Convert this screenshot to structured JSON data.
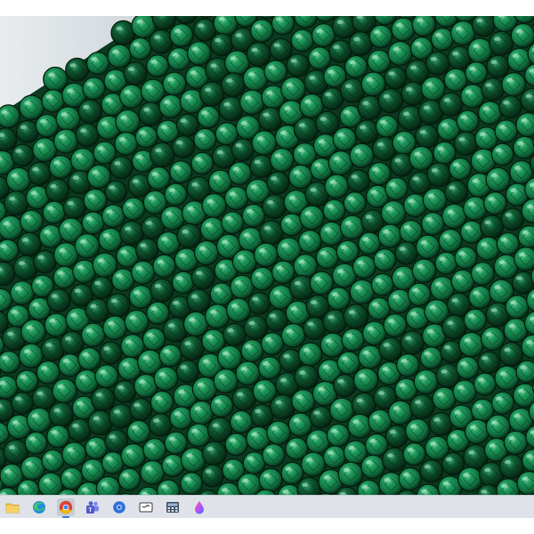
{
  "photo": {
    "subject": "malachite-bead-strands-photo",
    "colors": {
      "deep": "#0a3a1f",
      "mid": "#0f6b3c",
      "bright": "#1f9a5c",
      "highlight": "#7fd8a6",
      "dark": "#062816"
    }
  },
  "taskbar": {
    "background": "#dfe3e9",
    "apps": [
      {
        "id": "file-explorer",
        "icon": "folder-icon",
        "active": false
      },
      {
        "id": "edge",
        "icon": "edge-icon",
        "active": false
      },
      {
        "id": "chrome",
        "icon": "chrome-icon",
        "active": true
      },
      {
        "id": "teams",
        "icon": "teams-icon",
        "active": false
      },
      {
        "id": "app-blue",
        "icon": "blue-circle-app-icon",
        "active": false
      },
      {
        "id": "notes",
        "icon": "note-app-icon",
        "active": false
      },
      {
        "id": "calculator",
        "icon": "calculator-icon",
        "active": false
      },
      {
        "id": "color-app",
        "icon": "paint-drop-icon",
        "active": false
      }
    ]
  }
}
